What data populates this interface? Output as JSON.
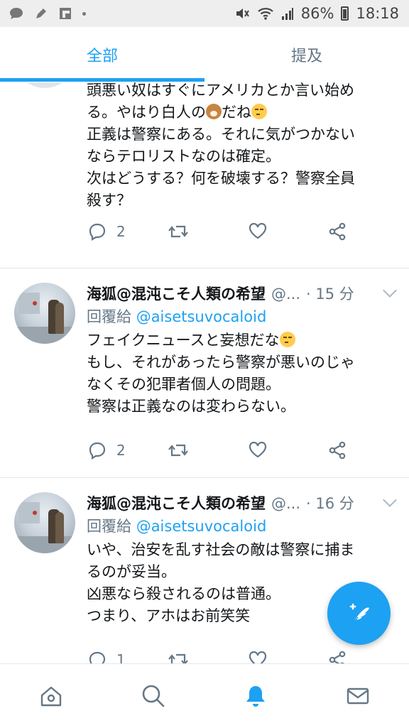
{
  "status_bar": {
    "battery": "86%",
    "time": "18:18"
  },
  "tabs": [
    {
      "label": "全部",
      "active": true
    },
    {
      "label": "提及",
      "active": false
    }
  ],
  "tweets": [
    {
      "body": [
        "頭悪い奴はすぐにアメリカとか言い始め",
        "る。やはり白人の",
        "だね",
        "正義は警察にある。それに気がつかない",
        "ならテロリストなのは確定。",
        "次はどうする？何を破壊する？警察全員",
        "殺す？"
      ],
      "reply_count": "2"
    },
    {
      "name": "海狐@混沌こそ人類の希望",
      "handle": "@...",
      "time": "· 15 分",
      "reply_prefix": "回覆給",
      "reply_to": "@aisetsuvocaloid",
      "body": [
        "フェイクニュースと妄想だな",
        "もし、それがあったら警察が悪いのじゃ",
        "なくその犯罪者個人の問題。",
        "警察は正義なのは変わらない。"
      ],
      "reply_count": "2"
    },
    {
      "name": "海狐@混沌こそ人類の希望",
      "handle": "@...",
      "time": "· 16 分",
      "reply_prefix": "回覆給",
      "reply_to": "@aisetsuvocaloid",
      "body": [
        "いや、治安を乱す社会の敵は警察に捕ま",
        "るのが妥当。",
        "凶悪なら殺されるのは普通。",
        "つまり、アホはお前笑笑"
      ],
      "reply_count": "1"
    }
  ],
  "icons": {
    "reply": "speech-bubble-icon",
    "retweet": "retweet-icon",
    "like": "heart-icon",
    "share": "share-icon",
    "compose": "compose-icon",
    "home": "home-icon",
    "search": "search-icon",
    "notifications": "bell-icon",
    "messages": "envelope-icon"
  },
  "colors": {
    "accent": "#1da1f2",
    "muted": "#657786",
    "text": "#14171a"
  }
}
